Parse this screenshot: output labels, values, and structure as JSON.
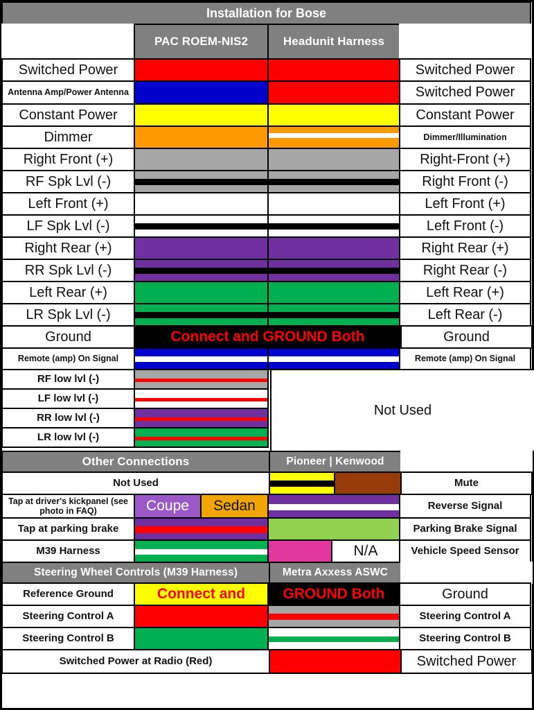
{
  "title": "Installation for Bose",
  "columns": {
    "left": "",
    "pac": "PAC ROEM-NIS2",
    "headunit": "Headunit Harness",
    "right": ""
  },
  "colors": {
    "header_gray": "#808080",
    "red": "#FF0000",
    "blue": "#0000CC",
    "yellow": "#FFFF00",
    "orange": "#FF9900",
    "gray": "#A6A6A6",
    "white": "#FFFFFF",
    "purple": "#7030A0",
    "green": "#00B050",
    "black": "#000000",
    "light_green": "#92D050",
    "brown": "#963C0A",
    "pink": "#E1379E",
    "coupe_purple": "#9B59C7",
    "sedan_amber": "#F0A500",
    "red_text": "#FF0000"
  },
  "bose_rows": [
    {
      "left": "Switched Power",
      "right": "Switched Power",
      "pac": "solid red",
      "head": "solid red"
    },
    {
      "left": "Antenna Amp/Power Antenna",
      "right": "Switched Power",
      "pac": "solid blue",
      "head": "solid red"
    },
    {
      "left": "Constant Power",
      "right": "Constant Power",
      "pac": "solid yellow",
      "head": "solid yellow"
    },
    {
      "left": "Dimmer",
      "right": "Dimmer/Illumination",
      "pac": "solid orange",
      "head": "orange with white stripe"
    },
    {
      "left": "Right Front (+)",
      "right": "Right-Front (+)",
      "pac": "solid gray",
      "head": "solid gray"
    },
    {
      "left": "RF Spk Lvl (-)",
      "right": "Right Front (-)",
      "pac": "gray with black stripe",
      "head": "gray with black stripe"
    },
    {
      "left": "Left Front (+)",
      "right": "Left Front (+)",
      "pac": "solid white",
      "head": "solid white"
    },
    {
      "left": "LF Spk Lvl (-)",
      "right": "Left Front (-)",
      "pac": "white with black stripe",
      "head": "white with black stripe"
    },
    {
      "left": "Right Rear (+)",
      "right": "Right Rear (+)",
      "pac": "solid purple",
      "head": "solid purple"
    },
    {
      "left": "RR Spk Lvl (-)",
      "right": "Right Rear (-)",
      "pac": "purple with black stripe",
      "head": "purple with black stripe"
    },
    {
      "left": "Left Rear (+)",
      "right": "Left Rear (+)",
      "pac": "solid green",
      "head": "solid green"
    },
    {
      "left": "LR Spk Lvl (-)",
      "right": "Left Rear (-)",
      "pac": "green with black stripe",
      "head": "green with black stripe"
    },
    {
      "left": "Ground",
      "right": "Ground",
      "merged_label": "Connect and GROUND Both",
      "merged_fill": "solid black"
    },
    {
      "left": "Remote (amp) On Signal",
      "right": "Remote (amp) On Signal",
      "pac": "blue with white stripe",
      "head": "blue with white stripe"
    }
  ],
  "low_level_rows": [
    {
      "left": "RF low lvl (-)",
      "pac": "gray with red stripe"
    },
    {
      "left": "LF low lvl (-)",
      "pac": "white with red stripe"
    },
    {
      "left": "RR low lvl (-)",
      "pac": "purple with red stripe"
    },
    {
      "left": "LR low lvl (-)",
      "pac": "green with red stripe"
    }
  ],
  "low_level_not_used": "Not Used",
  "other": {
    "section_title": "Other Connections",
    "column_title": "Pioneer | Kenwood",
    "rows": [
      {
        "left": "Not Used",
        "right": "Mute",
        "head_left": "yellow with black stripe",
        "head_right": "solid brown"
      },
      {
        "left": "Tap at driver's kickpanel (see photo in FAQ)",
        "right": "Reverse Signal",
        "pac_left_label": "Coupe",
        "pac_right_label": "Sedan",
        "head": "purple with white stripe"
      },
      {
        "left": "Tap at parking brake",
        "right": "Parking Brake Signal",
        "pac": "purple with red stripe",
        "head": "solid light green"
      },
      {
        "left": "M39 Harness",
        "right": "Vehicle Speed Sensor",
        "pac": "green with white stripe",
        "head_left": "solid pink",
        "head_right_label": "N/A"
      }
    ]
  },
  "swc": {
    "section_title": "Steering Wheel Controls (M39 Harness)",
    "column_title": "Metra Axxess ASWC",
    "rows": [
      {
        "left": "Reference Ground",
        "right": "Ground",
        "merged_label_a": "Connect and",
        "merged_label_b": "GROUND Both",
        "pac": "solid yellow",
        "head": "solid black"
      },
      {
        "left": "Steering Control A",
        "right": "Steering Control A",
        "pac": "solid red",
        "head": "gray with red stripe"
      },
      {
        "left": "Steering Control B",
        "right": "Steering Control B",
        "pac": "solid green",
        "head": "white with green stripe"
      },
      {
        "left": "Switched Power at Radio (Red)",
        "right": "Switched Power",
        "head": "solid red"
      }
    ]
  }
}
